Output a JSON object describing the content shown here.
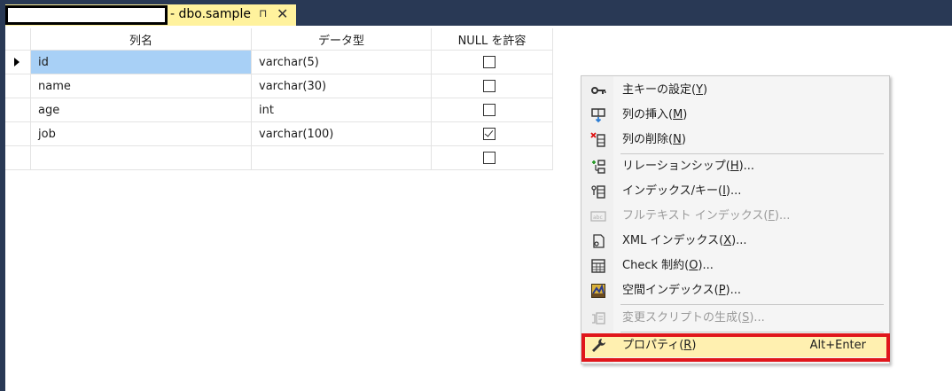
{
  "tab": {
    "title": "- dbo.sample",
    "pin_glyph": "⊓",
    "close_glyph": "✕"
  },
  "grid": {
    "columns": [
      "列名",
      "データ型",
      "NULL を許容"
    ],
    "rows": [
      {
        "name": "id",
        "type": "varchar(5)",
        "nullable": false,
        "selected": true
      },
      {
        "name": "name",
        "type": "varchar(30)",
        "nullable": false,
        "selected": false
      },
      {
        "name": "age",
        "type": "int",
        "nullable": false,
        "selected": false
      },
      {
        "name": "job",
        "type": "varchar(100)",
        "nullable": true,
        "selected": false
      },
      {
        "name": "",
        "type": "",
        "nullable": false,
        "selected": false
      }
    ]
  },
  "menu": {
    "items": [
      {
        "icon": "key-icon",
        "label": "主キーの設定(",
        "key": "Y",
        "suffix": ")",
        "shortcut": "",
        "disabled": false
      },
      {
        "icon": "insert-column-icon",
        "label": "列の挿入(",
        "key": "M",
        "suffix": ")",
        "shortcut": "",
        "disabled": false
      },
      {
        "icon": "delete-column-icon",
        "label": "列の削除(",
        "key": "N",
        "suffix": ")",
        "shortcut": "",
        "disabled": false
      },
      {
        "icon": "relationship-icon",
        "label": "リレーションシップ(",
        "key": "H",
        "suffix": ")...",
        "shortcut": "",
        "disabled": false
      },
      {
        "icon": "index-icon",
        "label": "インデックス/キー(",
        "key": "I",
        "suffix": ")...",
        "shortcut": "",
        "disabled": false
      },
      {
        "icon": "fulltext-icon",
        "label": "フルテキスト インデックス(",
        "key": "F",
        "suffix": ")...",
        "shortcut": "",
        "disabled": true
      },
      {
        "icon": "xml-icon",
        "label": "XML インデックス(",
        "key": "X",
        "suffix": ")...",
        "shortcut": "",
        "disabled": false
      },
      {
        "icon": "check-constraint-icon",
        "label": "Check 制約(",
        "key": "O",
        "suffix": ")...",
        "shortcut": "",
        "disabled": false
      },
      {
        "icon": "spatial-index-icon",
        "label": "空間インデックス(",
        "key": "P",
        "suffix": ")...",
        "shortcut": "",
        "disabled": false
      },
      {
        "icon": "generate-script-icon",
        "label": "変更スクリプトの生成(",
        "key": "S",
        "suffix": ")...",
        "shortcut": "",
        "disabled": true
      },
      {
        "icon": "wrench-icon",
        "label": "プロパティ(",
        "key": "R",
        "suffix": ")",
        "shortcut": "Alt+Enter",
        "disabled": false
      }
    ]
  },
  "colors": {
    "frame": "#293955",
    "tab_active": "#fff29d",
    "selected_cell": "#a8d0f6",
    "highlight_border": "#e0161b"
  }
}
